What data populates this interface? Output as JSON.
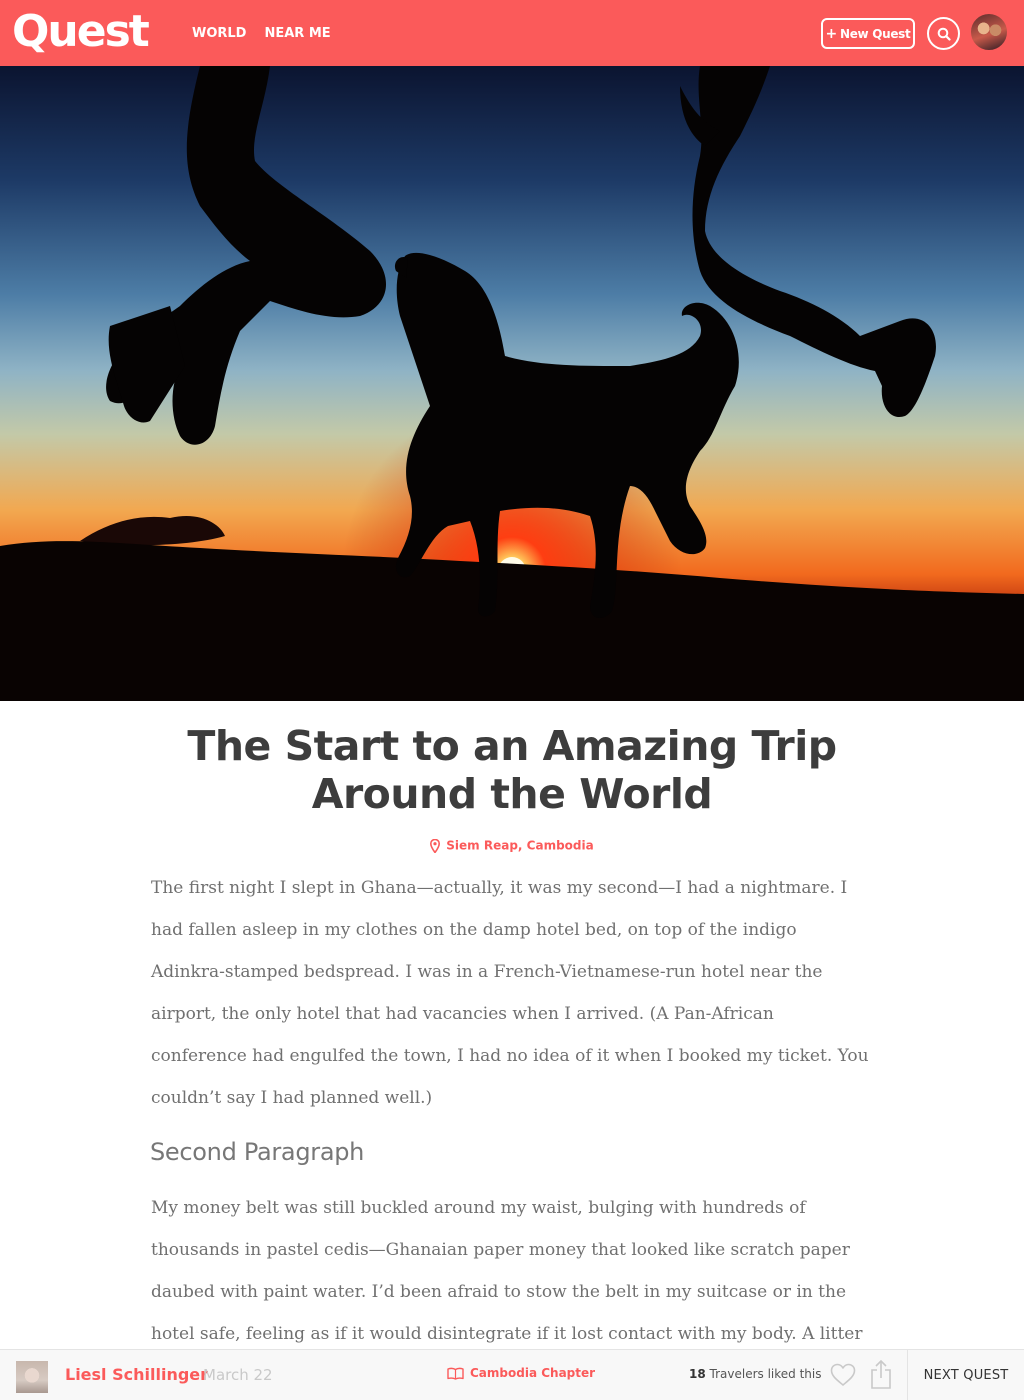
{
  "header": {
    "logo": "Quest",
    "nav": [
      "WORLD",
      "NEAR ME"
    ],
    "new_quest_label": "New Quest",
    "new_quest_icon": "plus-icon",
    "search_icon": "search-icon"
  },
  "colors": {
    "brand": "#fb5a5a",
    "title": "#3d3d3d",
    "body_text": "#707070",
    "footer_bg": "#f8f8f8"
  },
  "article": {
    "title": "The Start to an Amazing Trip Around the World",
    "location": "Siem Reap, Cambodia",
    "paragraph_1": "The first night I slept in Ghana—actually, it was my second—I had a nightmare. I had fallen asleep in my clothes on the damp hotel bed, on top of the indigo Adinkra-stamped bedspread. I was in a French-Vietnamese-run hotel near the airport, the only hotel that had vacancies when I arrived. (A Pan-African conference had engulfed the town, I had no idea of it when I booked my ticket. You couldn’t say I had planned well.)",
    "subheading": "Second Paragraph",
    "paragraph_2": "My money belt was still buckled around my waist, bulging with hundreds of thousands in pastel cedis—Ghanaian paper money that looked like scratch paper daubed with paint water. I’d been afraid to stow the belt in my suitcase or in the hotel safe, feeling as if it would disintegrate if it lost contact with my body. A litter of"
  },
  "footer": {
    "author": "Liesl Schillinger",
    "date": "March 22",
    "chapter": "Cambodia Chapter",
    "likes_count": "18",
    "likes_text": "Travelers liked this",
    "next_label": "NEXT QUEST"
  }
}
